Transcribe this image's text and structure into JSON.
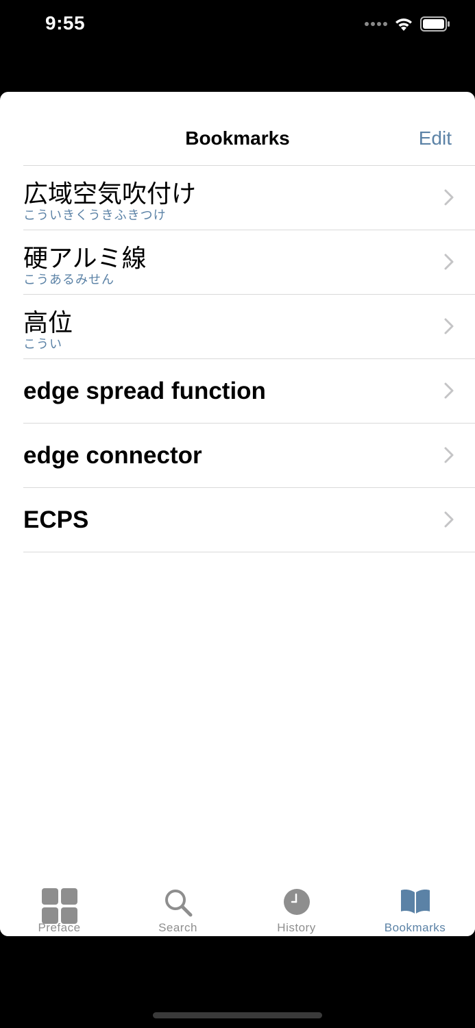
{
  "status_bar": {
    "time": "9:55"
  },
  "nav": {
    "title": "Bookmarks",
    "edit_label": "Edit"
  },
  "bookmarks": [
    {
      "term": "広域空気吹付け",
      "reading": "こういきくうきふきつけ"
    },
    {
      "term": "硬アルミ線",
      "reading": "こうあるみせん"
    },
    {
      "term": "高位",
      "reading": "こうい"
    },
    {
      "term": "edge spread function",
      "reading": ""
    },
    {
      "term": "edge connector",
      "reading": ""
    },
    {
      "term": "ECPS",
      "reading": ""
    }
  ],
  "tabs": [
    {
      "label": "Preface",
      "icon": "grid-icon",
      "active": false
    },
    {
      "label": "Search",
      "icon": "magnifier-icon",
      "active": false
    },
    {
      "label": "History",
      "icon": "clock-icon",
      "active": false
    },
    {
      "label": "Bookmarks",
      "icon": "book-icon",
      "active": true
    }
  ],
  "colors": {
    "accent": "#5b82a6",
    "inactive": "#8e8e8e",
    "separator": "#d9d9d9"
  }
}
